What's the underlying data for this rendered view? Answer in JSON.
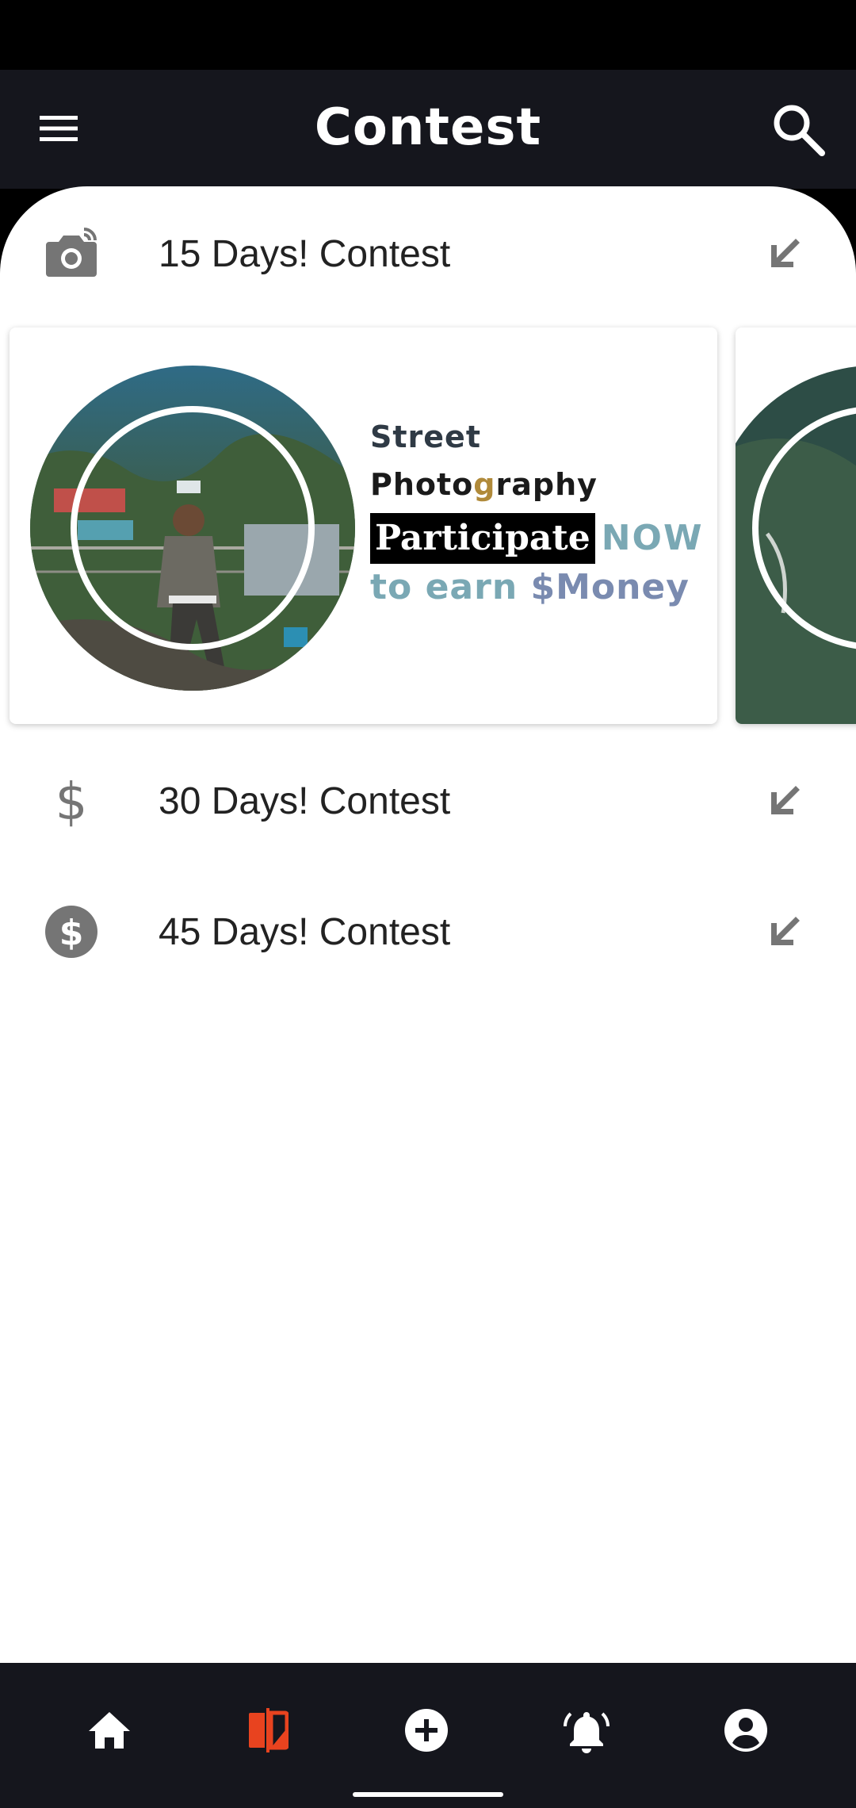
{
  "header": {
    "title": "Contest",
    "menu_icon": "menu-icon",
    "search_icon": "search-icon"
  },
  "contests": [
    {
      "label": "15 Days! Contest",
      "icon": "camera-icon",
      "trail_icon": "arrow-down-left-icon"
    },
    {
      "label": "30 Days! Contest",
      "icon": "dollar-icon",
      "trail_icon": "arrow-down-left-icon"
    },
    {
      "label": "45 Days! Contest",
      "icon": "dollar-circle-icon",
      "trail_icon": "arrow-down-left-icon"
    }
  ],
  "banner": {
    "line1": "Street",
    "line2_a": "Photo",
    "line2_g": "g",
    "line2_b": "raphy",
    "participate": "Participate",
    "now": "NOW",
    "earn": "to earn",
    "money": "$Money"
  },
  "bottom_nav": {
    "items": [
      {
        "icon": "home-icon",
        "active": false
      },
      {
        "icon": "contest-icon",
        "active": true
      },
      {
        "icon": "add-icon",
        "active": false
      },
      {
        "icon": "notification-bell-icon",
        "active": false
      },
      {
        "icon": "profile-icon",
        "active": false
      }
    ],
    "active_color": "#e8431f",
    "inactive_color": "#ffffff"
  },
  "colors": {
    "app_bar": "#15161d",
    "icon_grey": "#757575"
  }
}
